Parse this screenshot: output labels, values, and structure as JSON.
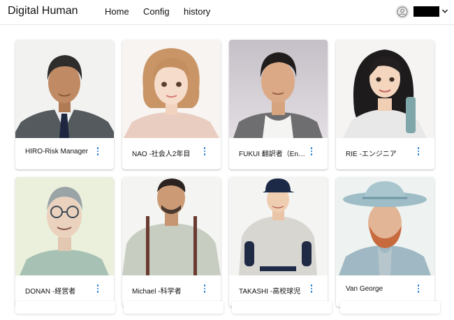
{
  "app": {
    "title": "Digital Human"
  },
  "nav": {
    "home": "Home",
    "config": "Config",
    "history": "history"
  },
  "user": {
    "icon": "account-circle-icon",
    "menu_icon": "chevron-down-icon"
  },
  "accent_color": "#1976d2",
  "cards": [
    {
      "label": "HIRO-Risk Manager"
    },
    {
      "label": "NAO -社会人2年目"
    },
    {
      "label": "FUKUI 翻訳者（English）"
    },
    {
      "label": "RIE -エンジニア"
    },
    {
      "label": "DONAN -経営者"
    },
    {
      "label": "Michael -科学者"
    },
    {
      "label": "TAKASHI -高校球児"
    },
    {
      "label": "Van George"
    }
  ]
}
